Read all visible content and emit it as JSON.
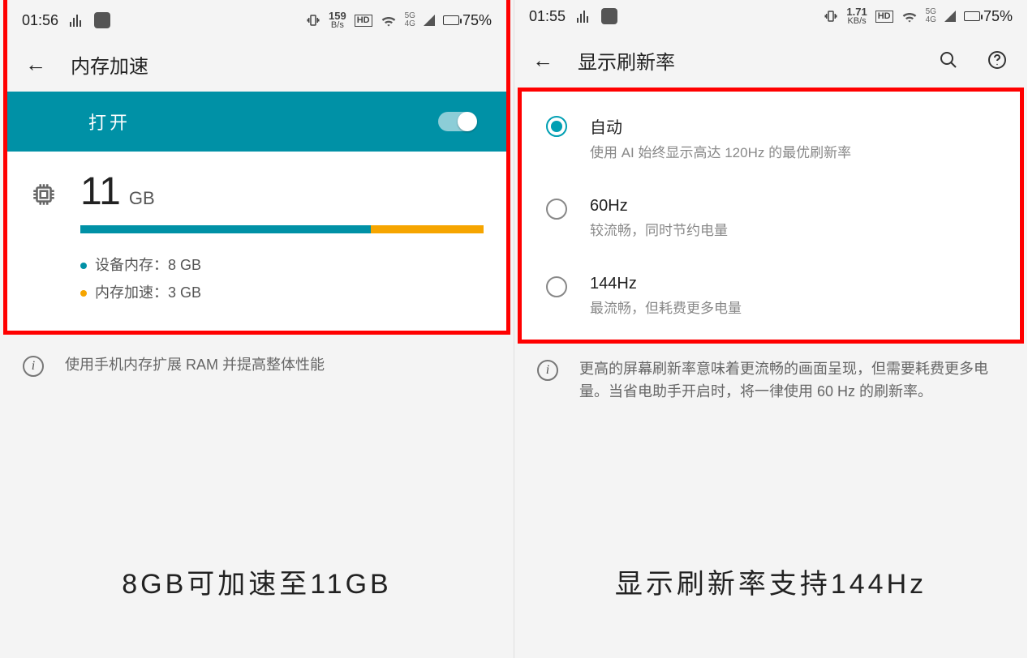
{
  "left": {
    "statusbar": {
      "time": "01:56",
      "speed_num": "159",
      "speed_unit": "B/s",
      "net_top": "5G",
      "net_bot": "4G",
      "battery": "75%"
    },
    "header": {
      "title": "内存加速"
    },
    "toggle": {
      "label": "打开"
    },
    "memory": {
      "value": "11",
      "unit": "GB",
      "bar_pct_a": 72,
      "bar_pct_b": 28,
      "legend_a": "设备内存：8 GB",
      "legend_b": "内存加速：3 GB"
    },
    "info": "使用手机内存扩展 RAM 并提高整体性能",
    "caption": "8GB可加速至11GB"
  },
  "right": {
    "statusbar": {
      "time": "01:55",
      "speed_num": "1.71",
      "speed_unit": "KB/s",
      "net_top": "5G",
      "net_bot": "4G",
      "battery": "75%"
    },
    "header": {
      "title": "显示刷新率"
    },
    "options": [
      {
        "checked": true,
        "title": "自动",
        "sub": "使用 AI 始终显示高达 120Hz 的最优刷新率"
      },
      {
        "checked": false,
        "title": "60Hz",
        "sub": "较流畅，同时节约电量"
      },
      {
        "checked": false,
        "title": "144Hz",
        "sub": "最流畅，但耗费更多电量"
      }
    ],
    "info": "更高的屏幕刷新率意味着更流畅的画面呈现，但需要耗费更多电量。当省电助手开启时，将一律使用 60 Hz 的刷新率。",
    "caption": "显示刷新率支持144Hz"
  }
}
